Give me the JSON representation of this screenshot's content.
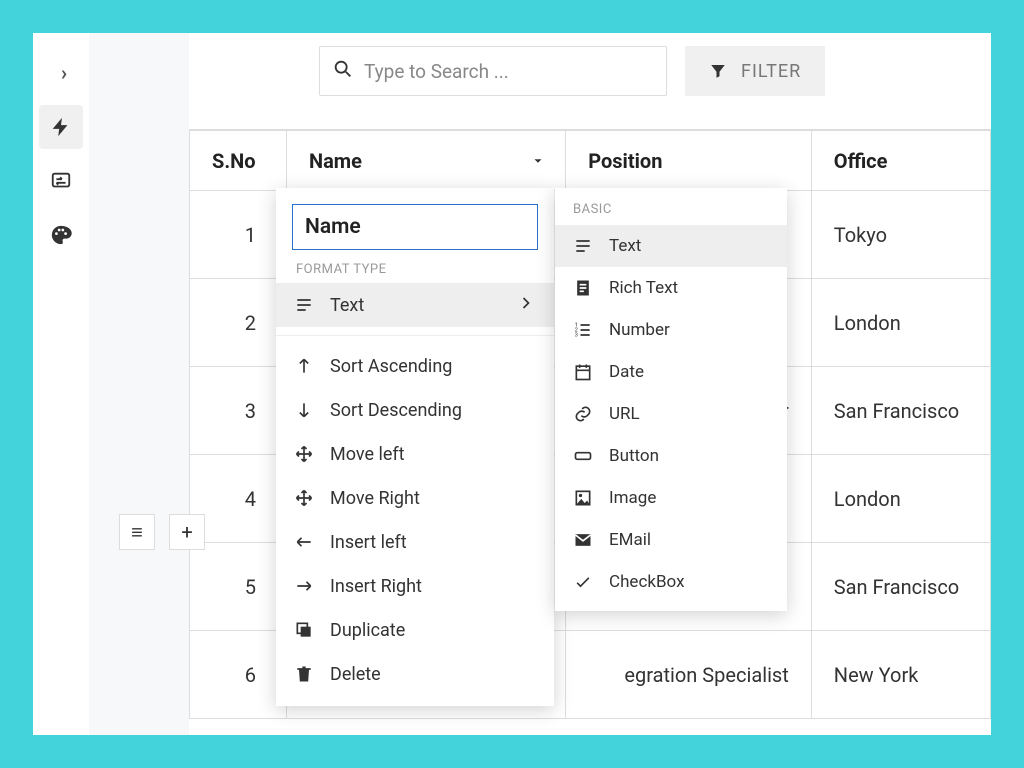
{
  "toolbar": {
    "search_placeholder": "Type to Search ...",
    "filter_label": "FILTER"
  },
  "columns": {
    "sno": "S.No",
    "name": "Name",
    "position": "Position",
    "office": "Office"
  },
  "rows": [
    {
      "sno": "1",
      "position": "",
      "office": "Tokyo"
    },
    {
      "sno": "2",
      "position": "",
      "office": "London"
    },
    {
      "sno": "3",
      "position": "hor",
      "office": "San Francisco"
    },
    {
      "sno": "4",
      "position": "",
      "office": "London"
    },
    {
      "sno": "5",
      "position": "",
      "office": "San Francisco"
    },
    {
      "sno": "6",
      "position": "egration Specialist",
      "office": "New York"
    }
  ],
  "col_menu": {
    "input_value": "Name",
    "format_type_label": "FORMAT TYPE",
    "current_format": "Text",
    "actions": {
      "sort_asc": "Sort Ascending",
      "sort_desc": "Sort Descending",
      "move_left": "Move left",
      "move_right": "Move Right",
      "insert_left": "Insert left",
      "insert_right": "Insert Right",
      "duplicate": "Duplicate",
      "delete": "Delete"
    }
  },
  "format_submenu": {
    "section_label": "BASIC",
    "items": {
      "text": "Text",
      "rich_text": "Rich Text",
      "number": "Number",
      "date": "Date",
      "url": "URL",
      "button": "Button",
      "image": "Image",
      "email": "EMail",
      "checkbox": "CheckBox"
    }
  }
}
